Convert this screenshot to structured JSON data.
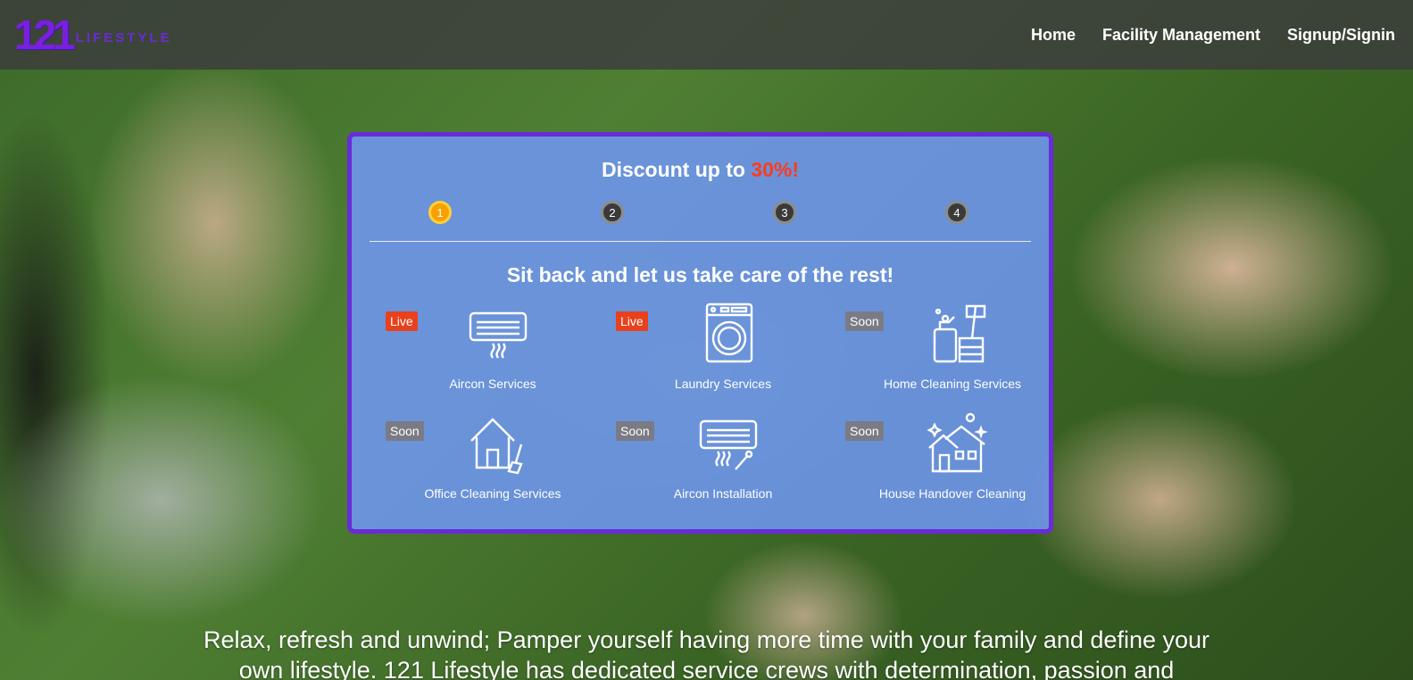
{
  "nav": {
    "logo_number": "121",
    "logo_text": "LIFESTYLE",
    "links": [
      "Home",
      "Facility Management",
      "Signup/Signin"
    ]
  },
  "promo": {
    "title_prefix": "Discount up to ",
    "title_accent": "30%!",
    "steps": [
      "1",
      "2",
      "3",
      "4"
    ],
    "active_step": 1,
    "tagline": "Sit back and let us take care of the rest!",
    "services": [
      {
        "label": "Aircon Services",
        "badge": "Live",
        "icon": "aircon-icon"
      },
      {
        "label": "Laundry Services",
        "badge": "Live",
        "icon": "washing-machine-icon"
      },
      {
        "label": "Home Cleaning Services",
        "badge": "Soon",
        "icon": "cleaning-supplies-icon"
      },
      {
        "label": "Office Cleaning Services",
        "badge": "Soon",
        "icon": "house-broom-icon"
      },
      {
        "label": "Aircon Installation",
        "badge": "Soon",
        "icon": "aircon-tools-icon"
      },
      {
        "label": "House Handover Cleaning",
        "badge": "Soon",
        "icon": "sparkling-house-icon"
      }
    ]
  },
  "hero": {
    "text": "Relax, refresh and unwind; Pamper yourself having more time with your family and define your own lifestyle. 121 Lifestyle has dedicated service crews with determination, passion and"
  },
  "colors": {
    "brand_purple": "#6a2bd9",
    "accent_red": "#e8411d",
    "step_active": "#f6a100",
    "card_bg": "#6e96f0"
  }
}
